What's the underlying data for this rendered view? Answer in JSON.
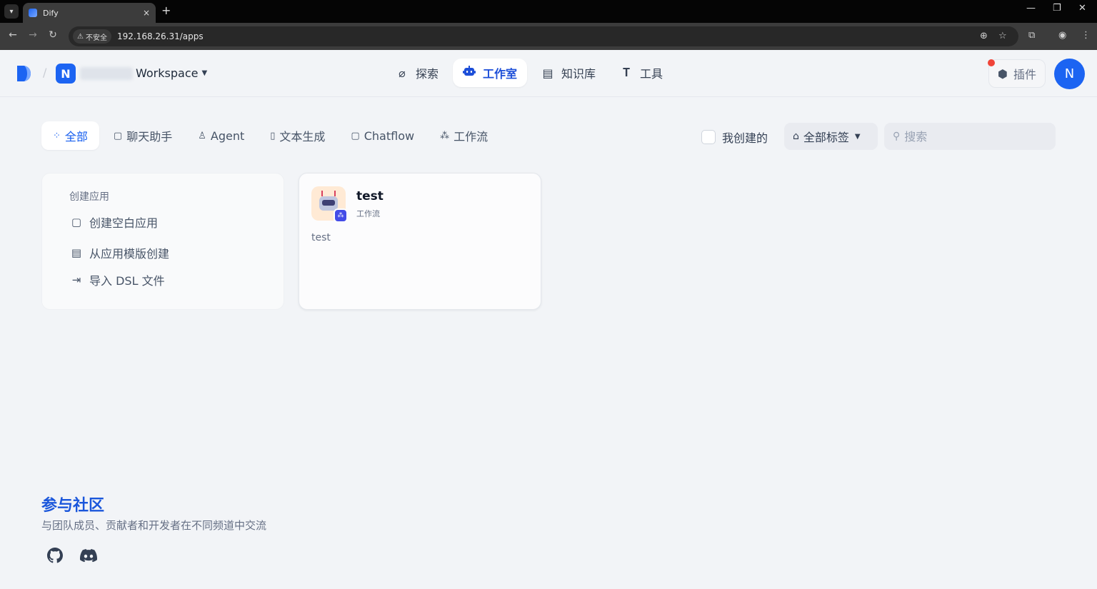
{
  "browser": {
    "tab_title": "Dify",
    "tab_close": "×",
    "new_tab": "+",
    "insecure_label": "不安全",
    "url": "192.168.26.31/apps",
    "window_controls": [
      "minimize-icon",
      "restore-icon",
      "close-icon"
    ]
  },
  "header": {
    "workspace_initial": "N",
    "workspace_name": "Workspace",
    "nav": [
      {
        "label": "探索",
        "icon": "explore-icon",
        "active": false
      },
      {
        "label": "工作室",
        "icon": "robot-icon",
        "active": true
      },
      {
        "label": "知识库",
        "icon": "knowledge-icon",
        "active": false
      },
      {
        "label": "工具",
        "icon": "tools-icon",
        "active": false
      }
    ],
    "plugin_label": "插件",
    "avatar_initial": "N"
  },
  "filters": {
    "tabs": [
      {
        "label": "全部",
        "icon": "grid-icon",
        "active": true
      },
      {
        "label": "聊天助手",
        "icon": "chat-icon",
        "active": false
      },
      {
        "label": "Agent",
        "icon": "agent-icon",
        "active": false
      },
      {
        "label": "文本生成",
        "icon": "document-icon",
        "active": false
      },
      {
        "label": "Chatflow",
        "icon": "chatflow-icon",
        "active": false
      },
      {
        "label": "工作流",
        "icon": "workflow-icon",
        "active": false
      }
    ],
    "mine_label": "我创建的",
    "tag_label": "全部标签",
    "search_placeholder": "搜索"
  },
  "create_card": {
    "title": "创建应用",
    "items": [
      {
        "label": "创建空白应用",
        "icon": "blank-file-icon"
      },
      {
        "label": "从应用模版创建",
        "icon": "template-icon"
      },
      {
        "label": "导入 DSL 文件",
        "icon": "import-icon"
      }
    ]
  },
  "apps": [
    {
      "name": "test",
      "type": "工作流",
      "description": "test",
      "icon": "robot-icon"
    }
  ],
  "community": {
    "title": "参与社区",
    "subtitle": "与团队成员、贡献者和开发者在不同频道中交流",
    "links": [
      "github-icon",
      "discord-icon"
    ]
  },
  "colors": {
    "brand": "#1c64f2",
    "active_tab": "#155eef",
    "background": "#f2f4f7"
  }
}
